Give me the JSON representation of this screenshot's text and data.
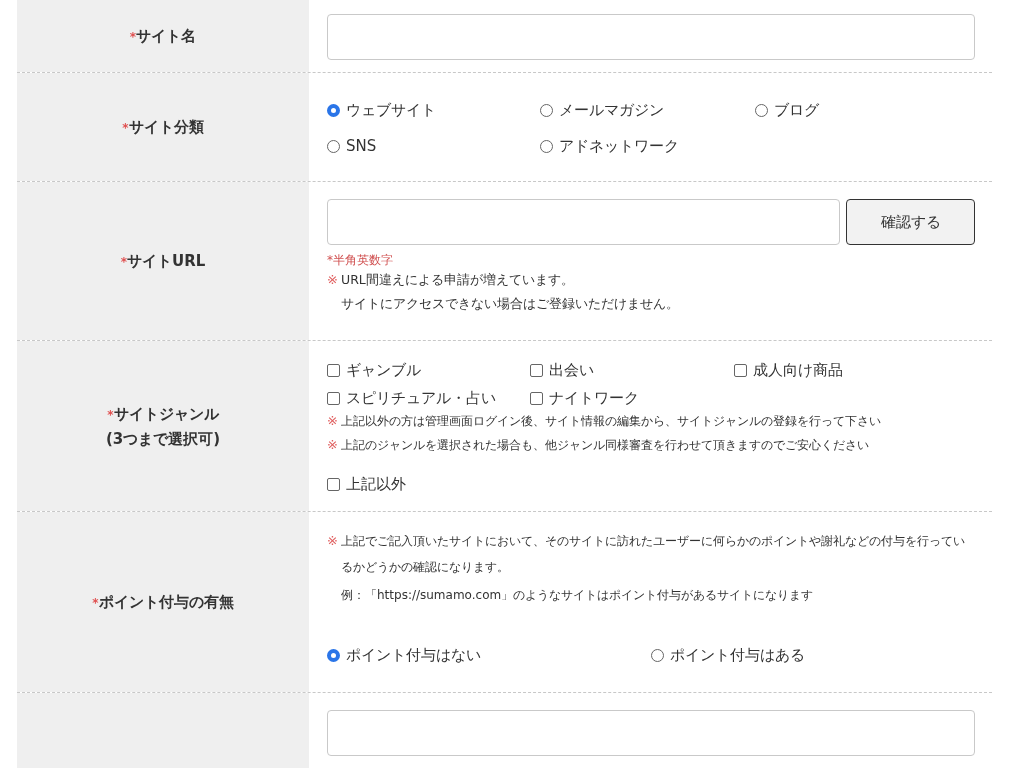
{
  "rows": [
    {
      "kind": "text",
      "required": "*",
      "label": [
        "サイト名"
      ]
    },
    {
      "kind": "radio",
      "required": "*",
      "label": [
        "サイト分類"
      ],
      "options": [
        {
          "label": "ウェブサイト",
          "selected": true
        },
        {
          "label": "メールマガジン",
          "selected": false
        },
        {
          "label": "ブログ",
          "selected": false
        },
        {
          "label": "SNS",
          "selected": false
        },
        {
          "label": "アドネットワーク",
          "selected": false
        }
      ]
    },
    {
      "kind": "url",
      "required": "*",
      "label": [
        "サイトURL"
      ],
      "button": "確認する",
      "hint": "*半角英数字",
      "notes": [
        {
          "mark": "※",
          "text": "URL間違えによる申請が増えています。"
        },
        {
          "text": "サイトにアクセスできない場合はご登録いただけません。"
        }
      ]
    },
    {
      "kind": "checkbox",
      "required": "*",
      "label": [
        "サイトジャンル",
        "(3つまで選択可)"
      ],
      "options": [
        {
          "label": "ギャンブル",
          "checked": false
        },
        {
          "label": "出会い",
          "checked": false
        },
        {
          "label": "成人向け商品",
          "checked": false
        },
        {
          "label": "スピリチュアル・占い",
          "checked": false
        },
        {
          "label": "ナイトワーク",
          "checked": false
        }
      ],
      "notes": [
        {
          "mark": "※",
          "text": "上記以外の方は管理画面ログイン後、サイト情報の編集から、サイトジャンルの登録を行って下さい"
        },
        {
          "mark": "※",
          "text": "上記のジャンルを選択された場合も、他ジャンル同様審査を行わせて頂きますのでご安心ください"
        }
      ],
      "extra": {
        "label": "上記以外",
        "checked": false
      }
    },
    {
      "kind": "points",
      "required": "*",
      "label": [
        "ポイント付与の有無"
      ],
      "notes": [
        {
          "mark": "※",
          "text": "上記でご記入頂いたサイトにおいて、そのサイトに訪れたユーザーに何らかのポイントや謝礼などの付与を行っているかどうかの確認になります。"
        },
        {
          "text": "例：「https://sumamo.com」のようなサイトはポイント付与があるサイトになります"
        }
      ],
      "options": [
        {
          "label": "ポイント付与はない",
          "selected": true
        },
        {
          "label": "ポイント付与はある",
          "selected": false
        }
      ]
    },
    {
      "kind": "text",
      "label": []
    }
  ]
}
